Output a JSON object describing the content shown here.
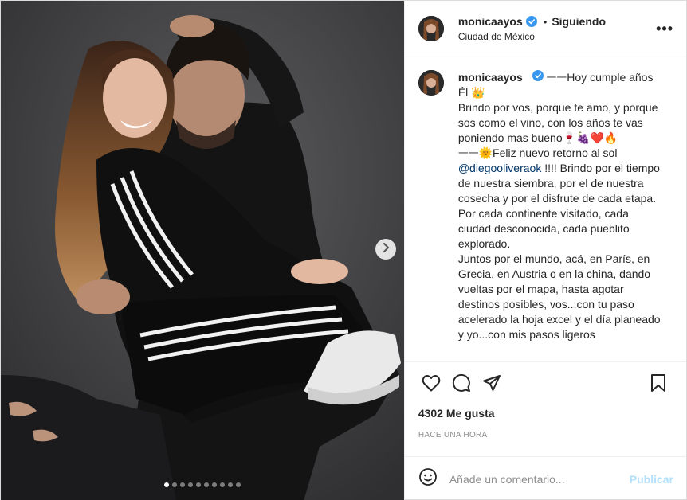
{
  "post": {
    "author": {
      "username": "monicaayos",
      "verified": true,
      "follow_status": "Siguiendo",
      "location": "Ciudad de México"
    },
    "header": {
      "separator": "•",
      "more_icon": "more-horizontal-icon",
      "more_label": "•••"
    },
    "caption": {
      "first_line": "ᅳᅳHoy cumple años Él 👑",
      "lines": [
        "Brindo por vos, porque te amo, y porque sos como el vino, con los años te vas poniendo mas bueno🍷🍇❤️🔥",
        "ᅳᅳ🌞Feliz nuevo retorno al sol",
        "!!!! Brindo por el tiempo de nuestra siembra, por el de nuestra cosecha y por el disfrute de cada etapa.",
        "Por cada continente visitado, cada ciudad desconocida, cada pueblito explorado.",
        "Juntos por el mundo, acá, en París, en Grecia, en Austria o en la china, dando vueltas por el mapa, hasta agotar destinos posibles, vos...con tu paso acelerado la hoja excel y el día planeado y yo...con mis pasos ligeros"
      ],
      "mention": "@diegooliveraok"
    },
    "likes": "4302 Me gusta",
    "timestamp": "HACE UNA HORA",
    "comment": {
      "placeholder": "Añade un comentario...",
      "submit_label": "Publicar"
    },
    "carousel": {
      "total_slides": 10,
      "active_index": 0
    }
  },
  "icons": {
    "like": "heart-icon",
    "comment": "comment-bubble-icon",
    "share": "paper-plane-icon",
    "save": "bookmark-icon",
    "emoji": "smiley-icon",
    "next": "chevron-right-icon",
    "verified": "verified-badge-icon"
  },
  "colors": {
    "verified": "#3897f0",
    "link": "#00376b",
    "publish_disabled": "#b2dffc",
    "muted": "#8e8e8e"
  }
}
